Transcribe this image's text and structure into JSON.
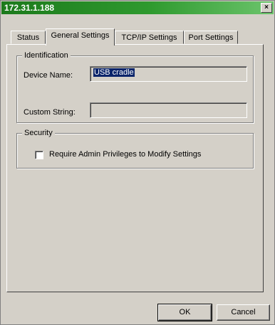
{
  "window": {
    "title": "172.31.1.188",
    "close_label": "×"
  },
  "tabs": [
    {
      "label": "Status"
    },
    {
      "label": "General Settings"
    },
    {
      "label": "TCP/IP Settings"
    },
    {
      "label": "Port Settings"
    }
  ],
  "identification": {
    "legend": "Identification",
    "device_name_label": "Device Name:",
    "device_name_value": "USB cradle",
    "custom_string_label": "Custom String:",
    "custom_string_value": ""
  },
  "security": {
    "legend": "Security",
    "require_admin_label": "Require Admin Privileges to Modify Settings",
    "require_admin_checked": false
  },
  "buttons": {
    "ok": "OK",
    "cancel": "Cancel"
  }
}
